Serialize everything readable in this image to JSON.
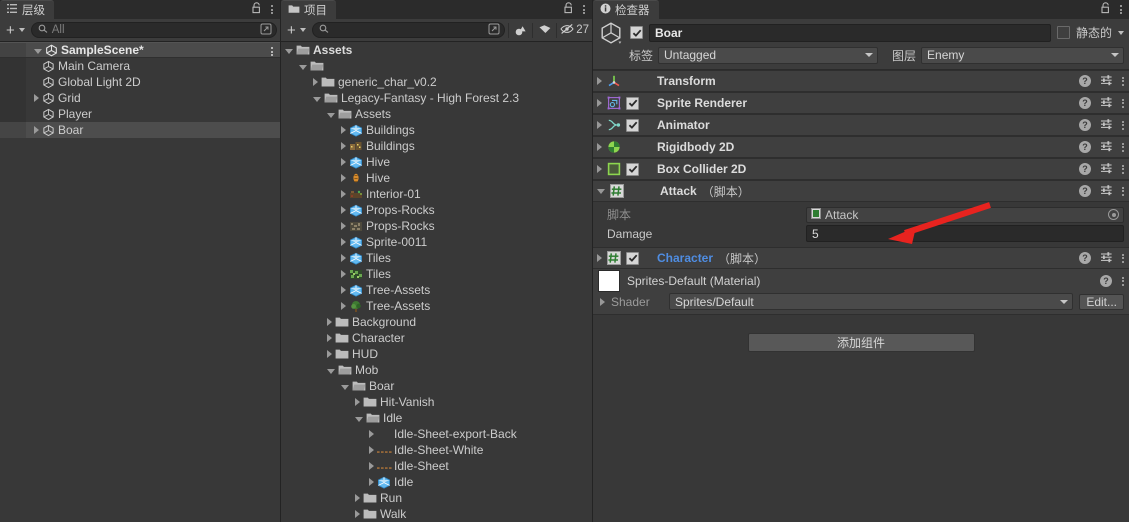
{
  "hierarchy": {
    "tab_label": "层级",
    "tab_icon": "hierarchy-icon",
    "lock_icon": "lock-icon",
    "menu_icon": "kebab-menu-icon",
    "toolbar": {
      "add_label": "+",
      "search_placeholder": "All",
      "search_icon": "search-icon",
      "popout_icon": "popout-icon"
    },
    "scene": {
      "label": "SampleScene*",
      "expanded": true,
      "icon": "unity-scene-icon"
    },
    "items": [
      {
        "label": "Main Camera",
        "depth": 2,
        "arrow": "none",
        "icon": "gameobject-icon",
        "selected": false
      },
      {
        "label": "Global Light 2D",
        "depth": 2,
        "arrow": "none",
        "icon": "gameobject-icon",
        "selected": false
      },
      {
        "label": "Grid",
        "depth": 2,
        "arrow": "collapsed",
        "icon": "gameobject-icon",
        "selected": false
      },
      {
        "label": "Player",
        "depth": 2,
        "arrow": "none",
        "icon": "gameobject-icon",
        "selected": false
      },
      {
        "label": "Boar",
        "depth": 2,
        "arrow": "collapsed",
        "icon": "gameobject-icon",
        "selected": true
      }
    ]
  },
  "project": {
    "tab_label": "项目",
    "tab_icon": "folder-icon",
    "lock_icon": "lock-icon",
    "menu_icon": "kebab-menu-icon",
    "toolbar": {
      "add_label": "+",
      "search_placeholder": "",
      "search_icon": "search-icon",
      "popout_icon": "popout-icon",
      "filter_type_icon": "filter-by-type-icon",
      "filter_label_icon": "filter-by-label-icon",
      "hidden_count_icon": "hidden-packages-icon",
      "hidden_count": "27"
    },
    "items": [
      {
        "label": "Assets",
        "depth": 0,
        "arrow": "expanded",
        "icon": "folder-open-icon",
        "bold": true
      },
      {
        "label": "",
        "depth": 1,
        "arrow": "expanded",
        "icon": "folder-open-icon",
        "bold": false
      },
      {
        "label": "generic_char_v0.2",
        "depth": 2,
        "arrow": "collapsed",
        "icon": "folder-icon",
        "bold": false
      },
      {
        "label": "Legacy-Fantasy - High Forest 2.3",
        "depth": 2,
        "arrow": "expanded",
        "icon": "folder-open-icon",
        "bold": false
      },
      {
        "label": "Assets",
        "depth": 3,
        "arrow": "expanded",
        "icon": "folder-open-icon",
        "bold": false
      },
      {
        "label": "Buildings",
        "depth": 4,
        "arrow": "collapsed",
        "icon": "prefab-icon",
        "bold": false
      },
      {
        "label": "Buildings",
        "depth": 4,
        "arrow": "collapsed",
        "icon": "sprite-buildings-icon",
        "bold": false
      },
      {
        "label": "Hive",
        "depth": 4,
        "arrow": "collapsed",
        "icon": "prefab-icon",
        "bold": false
      },
      {
        "label": "Hive",
        "depth": 4,
        "arrow": "collapsed",
        "icon": "sprite-hive-icon",
        "bold": false
      },
      {
        "label": "Interior-01",
        "depth": 4,
        "arrow": "collapsed",
        "icon": "sprite-interior-icon",
        "bold": false
      },
      {
        "label": "Props-Rocks",
        "depth": 4,
        "arrow": "collapsed",
        "icon": "prefab-icon",
        "bold": false
      },
      {
        "label": "Props-Rocks",
        "depth": 4,
        "arrow": "collapsed",
        "icon": "sprite-rocks-icon",
        "bold": false
      },
      {
        "label": "Sprite-0011",
        "depth": 4,
        "arrow": "collapsed",
        "icon": "prefab-icon",
        "bold": false
      },
      {
        "label": "Tiles",
        "depth": 4,
        "arrow": "collapsed",
        "icon": "prefab-icon",
        "bold": false
      },
      {
        "label": "Tiles",
        "depth": 4,
        "arrow": "collapsed",
        "icon": "sprite-tiles-icon",
        "bold": false
      },
      {
        "label": "Tree-Assets",
        "depth": 4,
        "arrow": "collapsed",
        "icon": "prefab-icon",
        "bold": false
      },
      {
        "label": "Tree-Assets",
        "depth": 4,
        "arrow": "collapsed",
        "icon": "sprite-tree-icon",
        "bold": false
      },
      {
        "label": "Background",
        "depth": 3,
        "arrow": "collapsed",
        "icon": "folder-icon",
        "bold": false
      },
      {
        "label": "Character",
        "depth": 3,
        "arrow": "collapsed",
        "icon": "folder-icon",
        "bold": false
      },
      {
        "label": "HUD",
        "depth": 3,
        "arrow": "collapsed",
        "icon": "folder-icon",
        "bold": false
      },
      {
        "label": "Mob",
        "depth": 3,
        "arrow": "expanded",
        "icon": "folder-open-icon",
        "bold": false
      },
      {
        "label": "Boar",
        "depth": 4,
        "arrow": "expanded",
        "icon": "folder-open-icon",
        "bold": false
      },
      {
        "label": "Hit-Vanish",
        "depth": 5,
        "arrow": "collapsed",
        "icon": "folder-icon",
        "bold": false
      },
      {
        "label": "Idle",
        "depth": 5,
        "arrow": "expanded",
        "icon": "folder-open-icon",
        "bold": false
      },
      {
        "label": "Idle-Sheet-export-Back",
        "depth": 6,
        "arrow": "collapsed",
        "icon": "none",
        "bold": false
      },
      {
        "label": "Idle-Sheet-White",
        "depth": 6,
        "arrow": "collapsed",
        "icon": "sprite-dots-icon",
        "bold": false
      },
      {
        "label": "Idle-Sheet",
        "depth": 6,
        "arrow": "collapsed",
        "icon": "sprite-dots-icon",
        "bold": false
      },
      {
        "label": "Idle",
        "depth": 6,
        "arrow": "collapsed",
        "icon": "prefab-icon",
        "bold": false
      },
      {
        "label": "Run",
        "depth": 5,
        "arrow": "collapsed",
        "icon": "folder-icon",
        "bold": false
      },
      {
        "label": "Walk",
        "depth": 5,
        "arrow": "collapsed",
        "icon": "folder-icon",
        "bold": false
      }
    ]
  },
  "inspector": {
    "tab_label": "检查器",
    "tab_icon": "info-icon",
    "lock_icon": "lock-icon",
    "menu_icon": "kebab-menu-icon",
    "object_icon": "gameobject-cube-icon",
    "enabled": true,
    "name": "Boar",
    "static_label": "静态的",
    "static_checked": false,
    "tag_label": "标签",
    "tag_value": "Untagged",
    "layer_label": "图层",
    "layer_value": "Enemy",
    "components": [
      {
        "name": "Transform",
        "suffix": "",
        "expanded": false,
        "has_checkbox": false,
        "checked": false,
        "icon": "transform-icon",
        "blue_title": false
      },
      {
        "name": "Sprite Renderer",
        "suffix": "",
        "expanded": false,
        "has_checkbox": true,
        "checked": true,
        "icon": "sprite-renderer-icon",
        "blue_title": false
      },
      {
        "name": "Animator",
        "suffix": "",
        "expanded": false,
        "has_checkbox": true,
        "checked": true,
        "icon": "animator-icon",
        "blue_title": false
      },
      {
        "name": "Rigidbody 2D",
        "suffix": "",
        "expanded": false,
        "has_checkbox": false,
        "checked": false,
        "icon": "rigidbody2d-icon",
        "blue_title": false
      },
      {
        "name": "Box Collider 2D",
        "suffix": "",
        "expanded": false,
        "has_checkbox": true,
        "checked": true,
        "icon": "boxcollider2d-icon",
        "blue_title": false
      }
    ],
    "attack": {
      "name": "Attack",
      "suffix": "（脚本）",
      "expanded": true,
      "icon": "cs-script-icon",
      "script_label": "脚本",
      "script_value": "Attack",
      "script_icon": "cs-script-asset-icon",
      "object_picker_icon": "object-picker-icon",
      "damage_label": "Damage",
      "damage_value": "5"
    },
    "character": {
      "name": "Character",
      "suffix": "（脚本）",
      "expanded": false,
      "has_checkbox": true,
      "checked": true,
      "icon": "cs-script-icon",
      "blue_title": true
    },
    "material": {
      "title": "Sprites-Default (Material)",
      "swatch_color": "#ffffff",
      "shader_label": "Shader",
      "shader_value": "Sprites/Default",
      "edit_label": "Edit...",
      "help_icon": "help-icon",
      "menu_icon": "kebab-menu-icon"
    },
    "add_component_label": "添加组件",
    "icons": {
      "help": "help-icon",
      "preset": "preset-icon",
      "menu": "kebab-menu-icon"
    }
  },
  "annotation": {
    "arrow_color": "#e8231f",
    "name": "red-arrow-pointing-to-damage-field"
  }
}
